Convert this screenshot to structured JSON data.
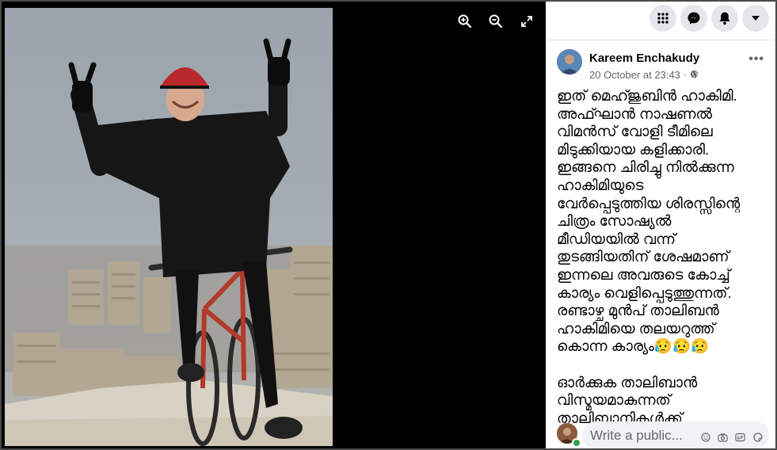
{
  "viewer": {
    "tools": [
      {
        "icon": "zoom-in-icon"
      },
      {
        "icon": "zoom-out-icon"
      },
      {
        "icon": "fullscreen-icon"
      }
    ]
  },
  "topbar": {
    "buttons": [
      {
        "icon": "menu-grid-icon"
      },
      {
        "icon": "messenger-icon"
      },
      {
        "icon": "notifications-bell-icon"
      },
      {
        "icon": "account-dropdown-icon"
      }
    ]
  },
  "post": {
    "author": "Kareem Enchakudy",
    "timestamp": "20 October at 23:43",
    "separator": "·",
    "privacy_icon": "globe-icon",
    "more_label": "•••",
    "body": "ഇത് മെഹ്ജുബിൻ ഹാകിമി.\nഅഫ്ഘാൻ നാഷണൽ\nവിമൻസ് വോളി ടീമിലെ\nമിടുക്കിയായ കളിക്കാരി.\nഇങ്ങനെ ചിരിച്ചു നിൽക്കുന്ന\nഹാകിമിയുടെ\nവേർപ്പെടുത്തിയ ശിരസ്സിന്റെ\nചിത്രം സോഷ്യൽ\nമീഡിയയിൽ വന്ന്\nതുടങ്ങിയതിന് ശേഷമാണ്\nഇന്നലെ അവരുടെ കോച്ച്\nകാര്യം വെളിപ്പെടുത്തുന്നത്.\nരണ്ടാഴ്ച മുൻപ് താലിബൻ\nഹാകിമിയെ തലയറുത്ത്\nകൊന്ന കാര്യം😥😥😥\n\nഓർക്കുക താലിബാൻ\nവിസ്മയമാകുന്നത്\nതാലിബാനികൾക്ക്"
  },
  "comment": {
    "placeholder": "Write a public...",
    "icons": [
      "emoji-icon",
      "camera-icon",
      "gif-icon",
      "sticker-icon"
    ]
  },
  "colors": {
    "accent": "#1877f2",
    "online": "#31a24c",
    "panel_bg": "#ffffff",
    "viewer_bg": "#000000"
  }
}
